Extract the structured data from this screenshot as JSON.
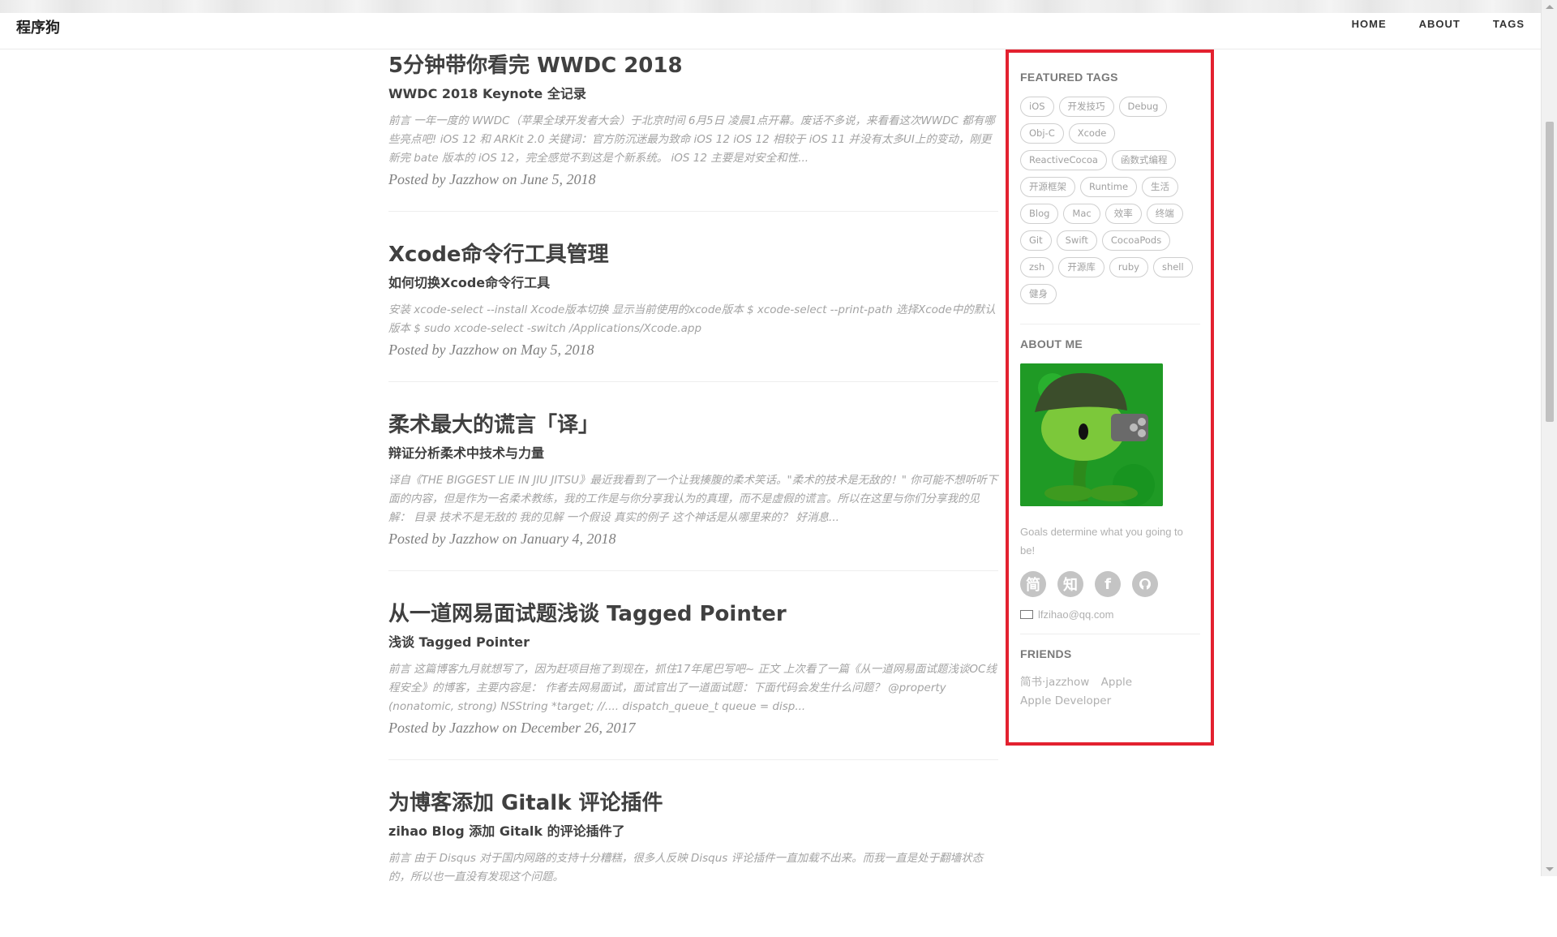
{
  "brand": "程序狗",
  "nav": [
    "HOME",
    "ABOUT",
    "TAGS"
  ],
  "posts": [
    {
      "title": "5分钟带你看完 WWDC 2018",
      "subtitle": "WWDC 2018 Keynote 全记录",
      "excerpt": "前言 一年一度的 WWDC（苹果全球开发者大会）于北京时间 6月5日 凌晨1点开幕。废话不多说，来看看这次WWDC 都有哪些亮点吧! iOS 12 和 ARKit 2.0 关键词：官方防沉迷最为致命 iOS 12 iOS 12 相较于 iOS 11 并没有太多UI上的变动，刚更新完 bate 版本的 iOS 12，完全感觉不到这是个新系统。 iOS 12 主要是对安全和性...",
      "meta": "Posted by Jazzhow on June 5, 2018"
    },
    {
      "title": "Xcode命令行工具管理",
      "subtitle": "如何切换Xcode命令行工具",
      "excerpt": "安装 xcode-select --install Xcode版本切换 显示当前使用的xcode版本 $ xcode-select --print-path 选择Xcode中的默认版本 $ sudo xcode-select -switch /Applications/Xcode.app",
      "meta": "Posted by Jazzhow on May 5, 2018"
    },
    {
      "title": "柔术最大的谎言「译」",
      "subtitle": "辩证分析柔术中技术与力量",
      "excerpt": "译自《THE BIGGEST LIE IN JIU JITSU》最近我看到了一个让我揍腹的柔术笑话。\"柔术的技术是无敌的！\" 你可能不想听听下面的内容，但是作为一名柔术教练，我的工作是与你分享我认为的真理，而不是虚假的谎言。所以在这里与你们分享我的见解： 目录 技术不是无敌的 我的见解 一个假设 真实的例子 这个神话是从哪里来的？ 好消息...",
      "meta": "Posted by Jazzhow on January 4, 2018"
    },
    {
      "title": "从一道网易面试题浅谈 Tagged Pointer",
      "subtitle": "浅谈 Tagged Pointer",
      "excerpt": "前言 这篇博客九月就想写了，因为赶项目拖了到现在，抓住17年尾巴写吧~ 正文 上次看了一篇《从一道网易面试题浅谈OC线程安全》的博客，主要内容是： 作者去网易面试，面试官出了一道面试题：下面代码会发生什么问题？ @property (nonatomic, strong) NSString *target; //.... dispatch_queue_t queue = disp...",
      "meta": "Posted by Jazzhow on December 26, 2017"
    },
    {
      "title": "为博客添加 Gitalk 评论插件",
      "subtitle": "zihao Blog 添加 Gitalk 的评论插件了",
      "excerpt": "前言 由于 Disqus 对于国内网路的支持十分糟糕，很多人反映 Disqus 评论插件一直加载不出来。而我一直是处于翻墙状态的，所以也一直没有发现这个问题。",
      "meta": ""
    }
  ],
  "sidebar": {
    "featured_tags_title": "FEATURED TAGS",
    "tags": [
      "iOS",
      "开发技巧",
      "Debug",
      "Obj-C",
      "Xcode",
      "ReactiveCocoa",
      "函数式编程",
      "开源框架",
      "Runtime",
      "生活",
      "Blog",
      "Mac",
      "效率",
      "终端",
      "Git",
      "Swift",
      "CocoaPods",
      "zsh",
      "开源库",
      "ruby",
      "shell",
      "健身"
    ],
    "about_title": "ABOUT ME",
    "about_text": "Goals determine what you going to be!",
    "socials": [
      "简",
      "知",
      "f",
      "gh"
    ],
    "email": "lfzihao@qq.com",
    "friends_title": "FRIENDS",
    "friends": [
      "简书·jazzhow",
      "Apple",
      "Apple Developer"
    ]
  },
  "colors": {
    "highlight_border": "#e3212f",
    "text": "#404040",
    "muted": "#a3a3a3"
  }
}
